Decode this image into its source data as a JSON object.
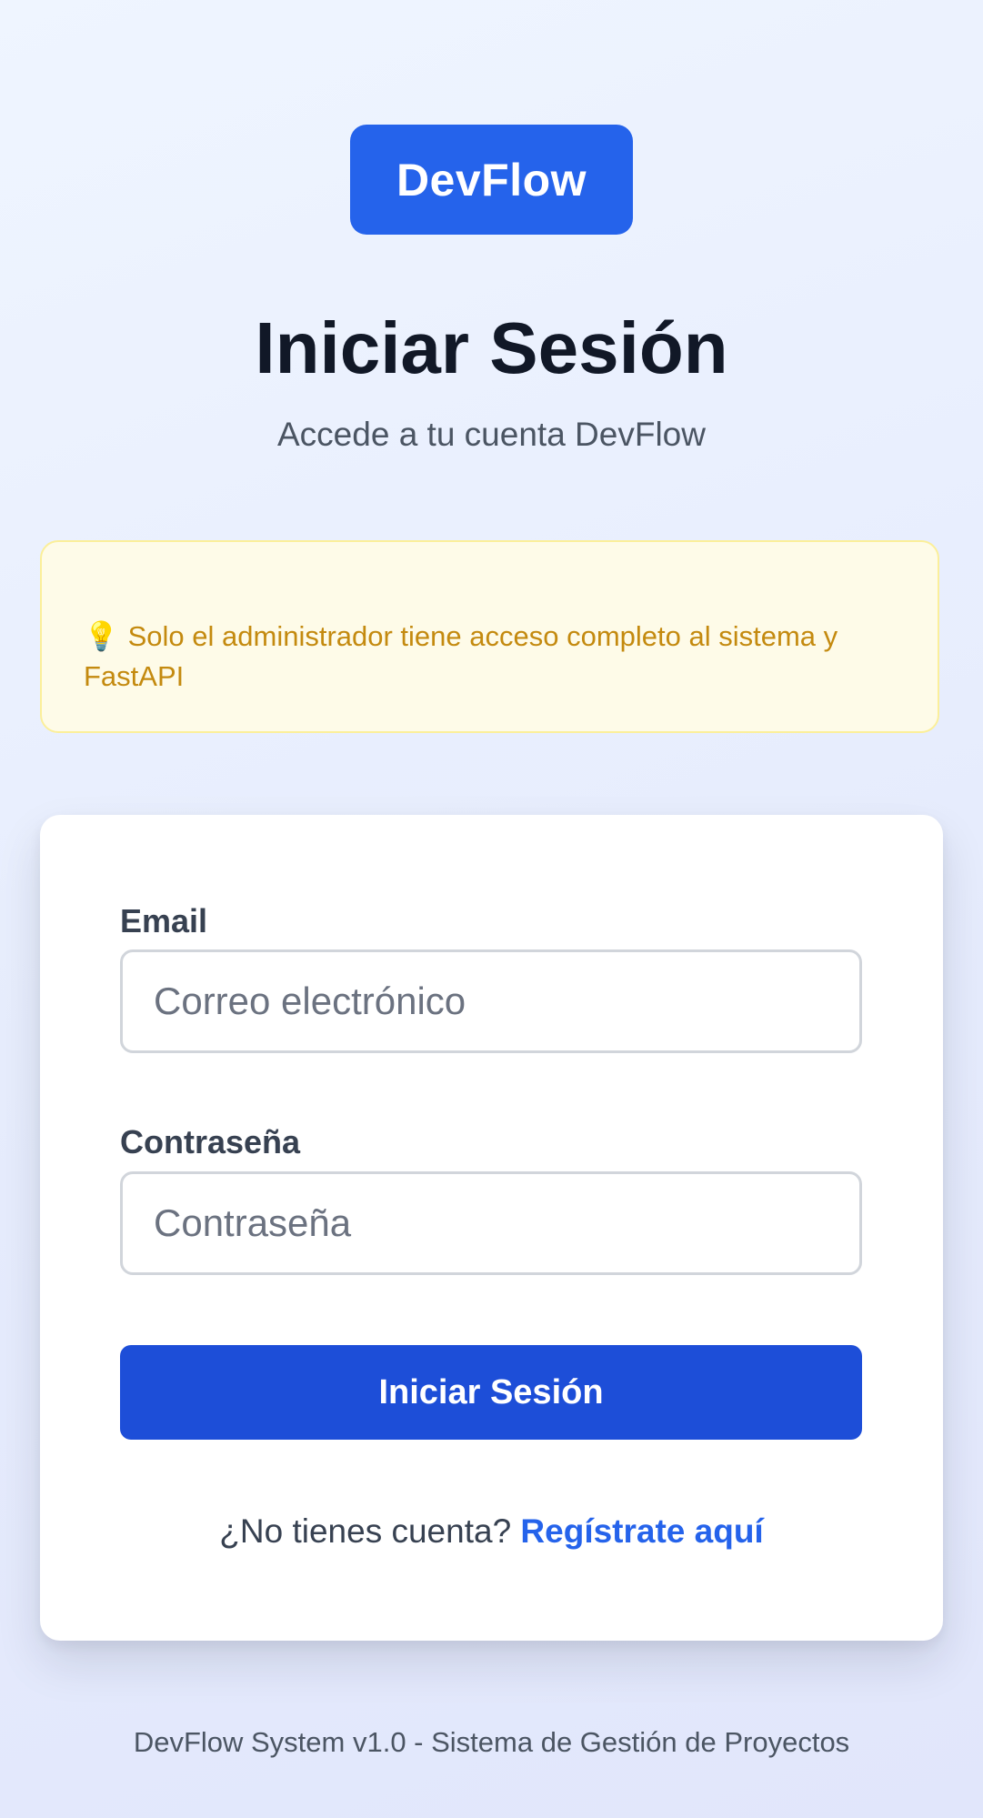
{
  "brand": {
    "logo_text": "DevFlow"
  },
  "header": {
    "title": "Iniciar Sesión",
    "subtitle": "Accede a tu cuenta DevFlow"
  },
  "notice": {
    "icon": "lightbulb-icon",
    "text": "Solo el administrador tiene acceso completo al sistema y FastAPI"
  },
  "form": {
    "email": {
      "label": "Email",
      "placeholder": "Correo electrónico",
      "value": ""
    },
    "password": {
      "label": "Contraseña",
      "placeholder": "Contraseña",
      "value": ""
    },
    "submit_label": "Iniciar Sesión",
    "register_prompt": "¿No tienes cuenta?",
    "register_link": "Regístrate aquí"
  },
  "footer": {
    "text": "DevFlow System v1.0 - Sistema de Gestión de Proyectos"
  },
  "colors": {
    "accent": "#2563eb",
    "button": "#1d4ed8",
    "notice_background": "#fefbe8",
    "notice_text": "#c48a0f"
  }
}
